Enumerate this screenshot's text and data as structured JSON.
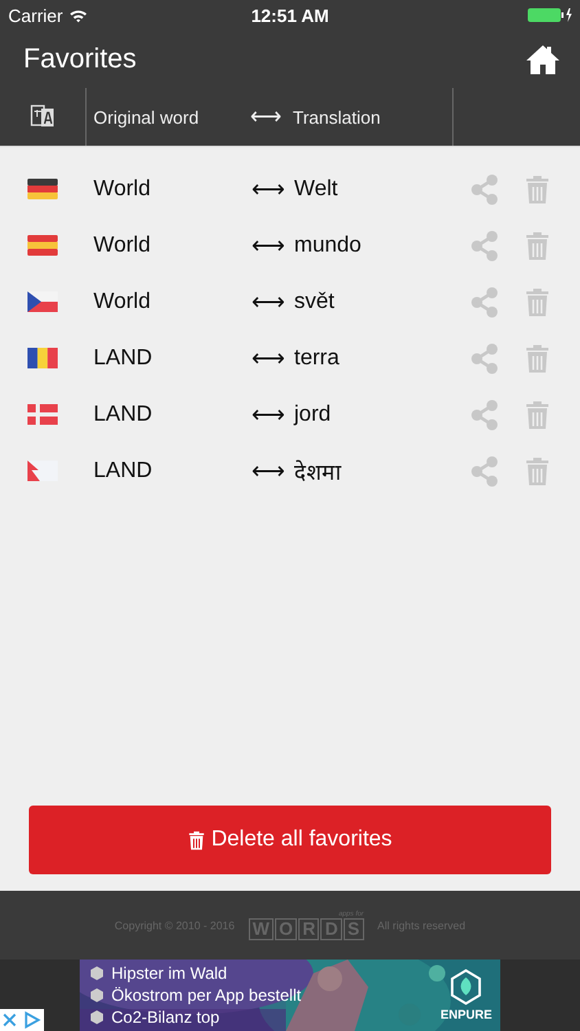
{
  "status_bar": {
    "carrier": "Carrier",
    "time": "12:51 AM"
  },
  "title_bar": {
    "title": "Favorites"
  },
  "header": {
    "original": "Original word",
    "arrow": "⟷",
    "translation": "Translation"
  },
  "favorites": [
    {
      "kind": "de",
      "original": "World",
      "arrow": "⟷",
      "translation": "Welt"
    },
    {
      "kind": "es",
      "original": "World",
      "arrow": "⟷",
      "translation": "mundo"
    },
    {
      "kind": "cz",
      "original": "World",
      "arrow": "⟷",
      "translation": "svět"
    },
    {
      "kind": "ro",
      "original": "LAND",
      "arrow": "⟷",
      "translation": "terra"
    },
    {
      "kind": "dk",
      "original": "LAND",
      "arrow": "⟷",
      "translation": "jord"
    },
    {
      "kind": "np",
      "original": "LAND",
      "arrow": "⟷",
      "translation": "देशमा"
    }
  ],
  "delete_all_button": "Delete all favorites",
  "footer": {
    "copyright": "Copyright © 2010 - 2016",
    "logo_small": "apps for",
    "logo": [
      "W",
      "O",
      "R",
      "D",
      "S"
    ],
    "rights": "All rights reserved"
  },
  "ad": {
    "lines": [
      "Hipster im Wald",
      "Ökostrom per App bestellt",
      "Co2-Bilanz top"
    ],
    "brand": "ENPURE"
  }
}
